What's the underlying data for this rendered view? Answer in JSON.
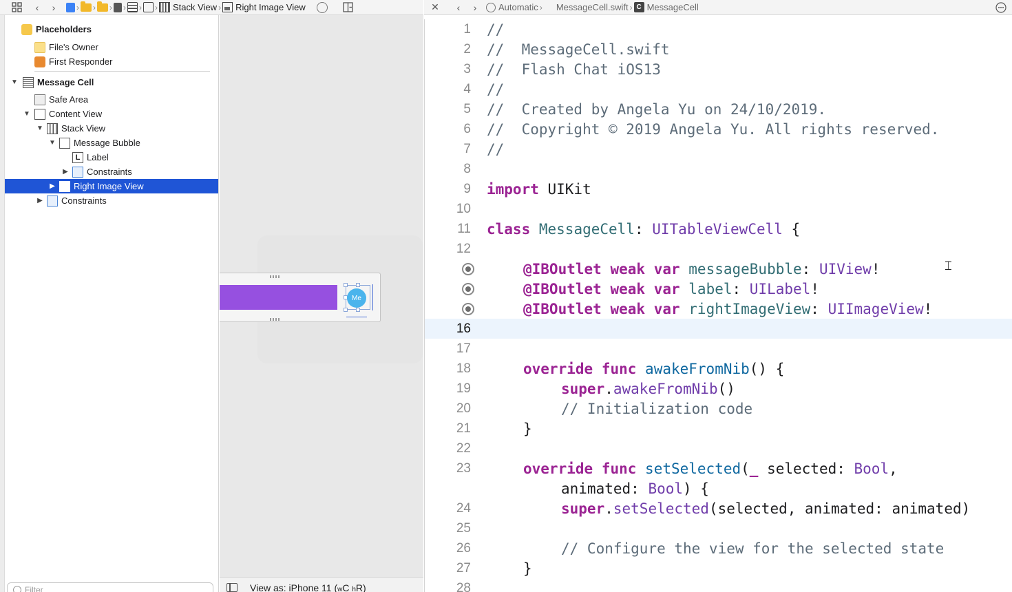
{
  "left_toolbar": {
    "breadcrumbs": [
      "Stack View",
      "Right Image View"
    ]
  },
  "right_toolbar": {
    "breadcrumbs": [
      "Automatic",
      "MessageCell.swift",
      "MessageCell"
    ]
  },
  "outline": {
    "placeholders_title": "Placeholders",
    "files_owner": "File's Owner",
    "first_responder": "First Responder",
    "items": [
      {
        "label": "Message Cell"
      },
      {
        "label": "Safe Area"
      },
      {
        "label": "Content View"
      },
      {
        "label": "Stack View"
      },
      {
        "label": "Message Bubble"
      },
      {
        "label": "Label"
      },
      {
        "label": "Constraints"
      },
      {
        "label": "Right Image View"
      },
      {
        "label": "Constraints"
      }
    ],
    "filter_placeholder": "Filter"
  },
  "canvas": {
    "avatar_text": "Me",
    "view_as_prefix": "View as: iPhone 11 (",
    "size_w": "w",
    "size_c": "C ",
    "size_h": "h",
    "size_r": "R)",
    "bubble_color": "#9650e0",
    "avatar_color": "#4ab4ec"
  },
  "editor": {
    "lines": [
      {
        "n": "1",
        "text": "//"
      },
      {
        "n": "2",
        "text": "//  MessageCell.swift"
      },
      {
        "n": "3",
        "text": "//  Flash Chat iOS13"
      },
      {
        "n": "4",
        "text": "//"
      },
      {
        "n": "5",
        "text": "//  Created by Angela Yu on 24/10/2019."
      },
      {
        "n": "6",
        "text": "//  Copyright © 2019 Angela Yu. All rights reserved."
      },
      {
        "n": "7",
        "text": "//"
      },
      {
        "n": "8",
        "text": ""
      },
      {
        "n": "9",
        "text": "import UIKit"
      },
      {
        "n": "10",
        "text": ""
      },
      {
        "n": "11",
        "text": "class MessageCell: UITableViewCell {"
      },
      {
        "n": "12",
        "text": ""
      },
      {
        "n": "",
        "text": "@IBOutlet weak var messageBubble: UIView!"
      },
      {
        "n": "",
        "text": "@IBOutlet weak var label: UILabel!"
      },
      {
        "n": "",
        "text": "@IBOutlet weak var rightImageView: UIImageView!"
      },
      {
        "n": "16",
        "text": ""
      },
      {
        "n": "17",
        "text": ""
      },
      {
        "n": "18",
        "text": "override func awakeFromNib() {"
      },
      {
        "n": "19",
        "text": "super.awakeFromNib()"
      },
      {
        "n": "20",
        "text": "// Initialization code"
      },
      {
        "n": "21",
        "text": "}"
      },
      {
        "n": "22",
        "text": ""
      },
      {
        "n": "23",
        "text": "override func setSelected(_ selected: Bool,"
      },
      {
        "n": "",
        "text": "animated: Bool) {"
      },
      {
        "n": "24",
        "text": "super.setSelected(selected, animated: animated)"
      },
      {
        "n": "25",
        "text": ""
      },
      {
        "n": "26",
        "text": "// Configure the view for the selected state"
      },
      {
        "n": "27",
        "text": "}"
      },
      {
        "n": "28",
        "text": ""
      }
    ],
    "current_line": "16",
    "colors": {
      "keyword": "#9b2393",
      "comment": "#5d6c79",
      "type": "#703daa",
      "property": "#326d74",
      "function": "#0f68a0",
      "current_line_bg": "#ecf4fd",
      "selection": "#1f55d6"
    }
  },
  "icons": [
    "grid-icon",
    "back-icon",
    "forward-icon",
    "swift-file-icon",
    "folder-icon",
    "storyboard-icon",
    "view-icon",
    "stack-view-icon",
    "image-view-icon",
    "related-items-icon",
    "add-editor-icon",
    "close-icon",
    "class-icon",
    "options-icon"
  ]
}
